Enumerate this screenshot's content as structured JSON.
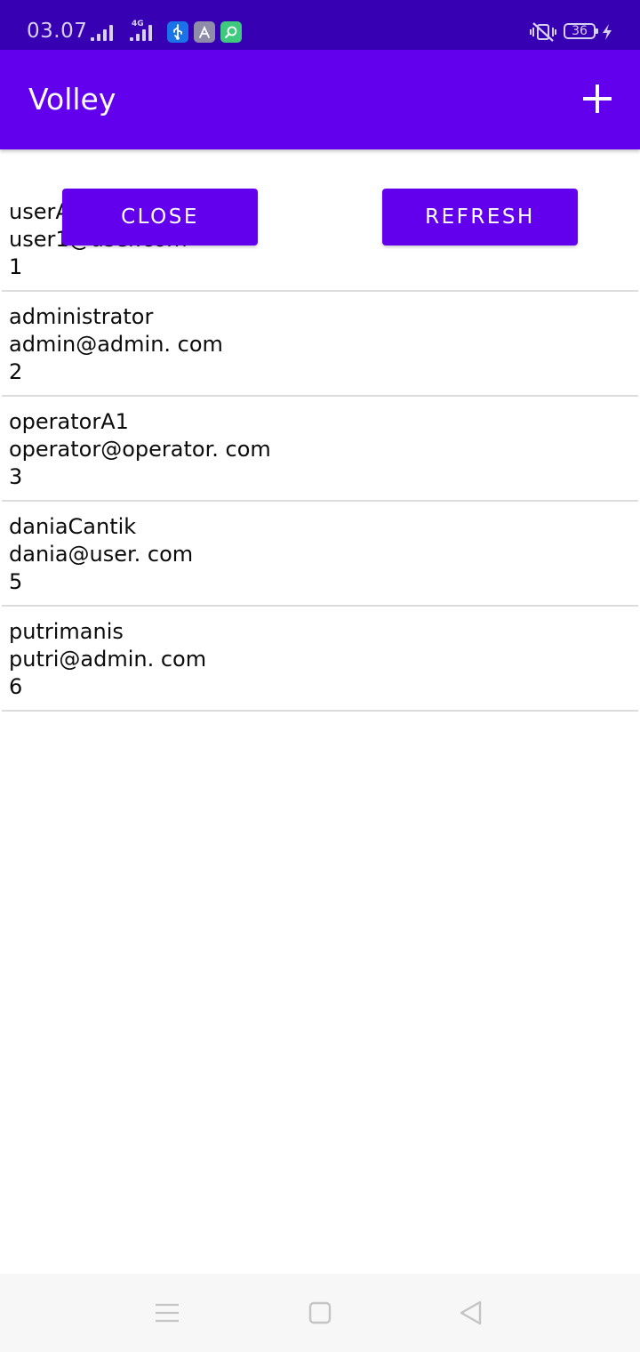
{
  "status_bar": {
    "time": "03.07",
    "network_label": "4G",
    "battery_level": "36",
    "icons": [
      "signal-icon",
      "signal-4g-icon",
      "usb-icon",
      "app-store-icon",
      "search-app-icon",
      "vibrate-off-icon",
      "battery-icon",
      "charging-icon"
    ]
  },
  "app_bar": {
    "title": "Volley",
    "action_icon": "add-icon"
  },
  "buttons": {
    "close_label": "CLOSE",
    "refresh_label": "REFRESH"
  },
  "users": [
    {
      "username": "userA",
      "email": "user1@user.com",
      "id": "1"
    },
    {
      "username": "administrator",
      "email": "admin@admin. com",
      "id": "2"
    },
    {
      "username": "operatorA1",
      "email": "operator@operator. com",
      "id": "3"
    },
    {
      "username": "daniaCantik",
      "email": "dania@user. com",
      "id": "5"
    },
    {
      "username": "putrimanis",
      "email": "putri@admin. com",
      "id": "6"
    }
  ],
  "nav_bar": {
    "icons": [
      "menu-icon",
      "home-icon",
      "back-icon"
    ]
  },
  "colors": {
    "status_bar": "#3700b3",
    "primary": "#6200ee",
    "divider": "#dcdcdc"
  }
}
